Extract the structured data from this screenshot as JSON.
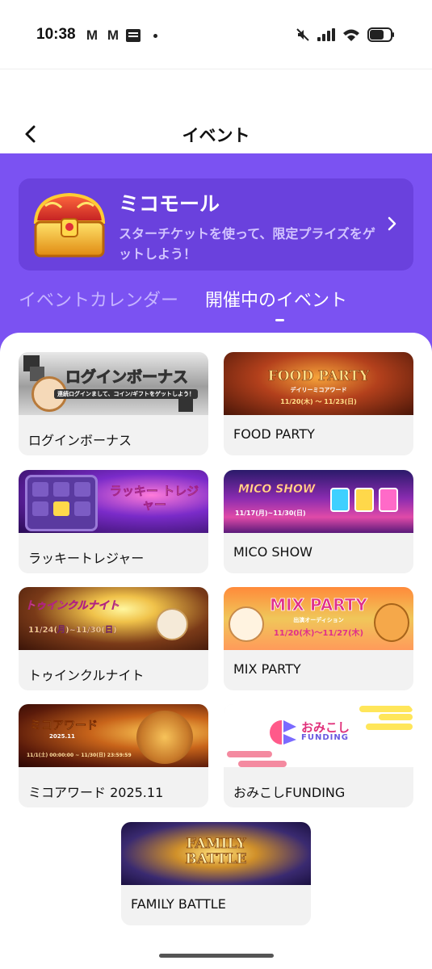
{
  "status_bar": {
    "time": "10:38",
    "left_icons": [
      "gmail-icon",
      "gmail-icon",
      "app-icon",
      "dot-icon"
    ],
    "right_icons": [
      "mute-icon",
      "signal-icon",
      "wifi-icon",
      "battery-icon"
    ]
  },
  "header": {
    "title": "イベント",
    "back_icon": "back-arrow-icon"
  },
  "mall": {
    "title": "ミコモール",
    "description": "スターチケットを使って、限定プライズをゲットしよう！",
    "icon": "treasure-chest-icon",
    "chevron": "chevron-right-icon"
  },
  "tabs": [
    {
      "label": "イベントカレンダー",
      "active": false
    },
    {
      "label": "開催中のイベント",
      "active": true
    }
  ],
  "events": [
    {
      "label": "ログインボーナス",
      "banner": {
        "title": "ログインボーナス",
        "subtitle": "連続ログインまして、コイン/ギフトをゲットしよう！"
      }
    },
    {
      "label": "FOOD PARTY",
      "banner": {
        "title": "FOOD PARTY",
        "subtitle": "デイリーミコアワード",
        "dates": "11/20(木) ～ 11/23(日)"
      }
    },
    {
      "label": "ラッキートレジャー",
      "banner": {
        "title": "ラッキー トレジャー"
      }
    },
    {
      "label": "MICO SHOW",
      "banner": {
        "title": "MICO SHOW",
        "dates": "11/17(月)~11/30(日)"
      }
    },
    {
      "label": "トゥインクルナイト",
      "banner": {
        "title": "トゥインクルナイト",
        "dates": "11/24(月)~11/30(日)"
      }
    },
    {
      "label": "MIX PARTY",
      "banner": {
        "title": "MIX PARTY",
        "subtitle": "出演オーディション",
        "dates": "11/20(木)～11/27(木)"
      }
    },
    {
      "label": "ミコアワード 2025.11",
      "banner": {
        "title": "ミコアワード",
        "subtitle": "2025.11",
        "dates": "11/1(土) 00:00:00 ~ 11/30(日) 23:59:59"
      }
    },
    {
      "label": "おみこしFUNDING",
      "banner": {
        "title": "おみこし",
        "subtitle": "FUNDING"
      }
    },
    {
      "label": "FAMILY BATTLE",
      "banner": {
        "title": "FAMILY BATTLE"
      }
    }
  ],
  "colors": {
    "accent": "#7b52f2",
    "mall_card": "#6a41dd",
    "card_bg": "#f2f2f2",
    "tab_inactive": "#c6b4ff"
  }
}
